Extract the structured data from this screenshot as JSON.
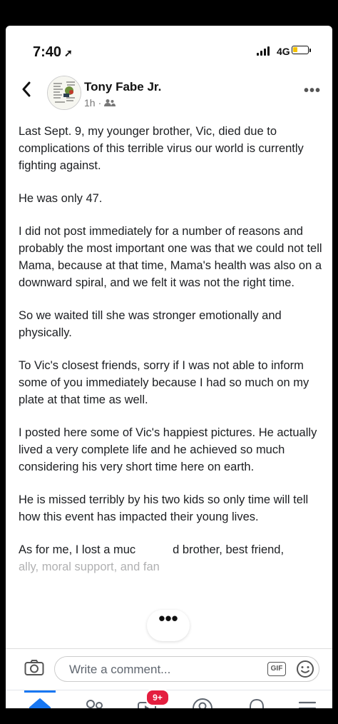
{
  "status_bar": {
    "time": "7:40",
    "location_icon": "navigation-arrow-icon",
    "network": "4G"
  },
  "post_header": {
    "author": "Tony Fabe Jr.",
    "time_ago": "1h",
    "separator": "·",
    "audience_icon": "friends-icon",
    "more_label": "•••"
  },
  "post_body": {
    "paragraphs": [
      "Last Sept. 9, my younger brother, Vic, died due to complications of this terrible virus our world is currently fighting against.",
      "He was only 47.",
      "I did not post immediately for a number of reasons and probably the most important one was that we could not tell Mama, because at that time, Mama's health was also on a downward spiral, and we felt it was not the right time.",
      "So we waited till she was stronger emotionally and physically.",
      "To Vic's closest friends, sorry if I was not able to inform some of you immediately because I had so much on my plate at that time as well.",
      "I posted here some of Vic's happiest pictures. He actually lived a very complete life and he achieved so much considering his very short time here on earth.",
      "He is missed terribly by his two kids so only time will tell how this event has impacted their young lives."
    ],
    "last_line": "As for me, I lost a muc",
    "last_line_end": "d brother, best friend,",
    "cutoff_line": "ally, moral support, and fan",
    "dots_label": "•••"
  },
  "comment_bar": {
    "placeholder": "Write a comment...",
    "gif_label": "GIF"
  },
  "tab_bar": {
    "tabs": [
      {
        "name": "home",
        "icon": "home-icon",
        "active": true
      },
      {
        "name": "friends",
        "icon": "friends-icon",
        "active": false
      },
      {
        "name": "watch",
        "icon": "watch-icon",
        "active": false
      },
      {
        "name": "profile",
        "icon": "profile-icon",
        "active": false
      },
      {
        "name": "notifications",
        "icon": "bell-icon",
        "active": false
      },
      {
        "name": "menu",
        "icon": "menu-icon",
        "active": false
      }
    ],
    "watch_badge": "9+"
  },
  "colors": {
    "accent": "#1877f2",
    "badge": "#e41e3f",
    "battery": "#f4c200"
  }
}
